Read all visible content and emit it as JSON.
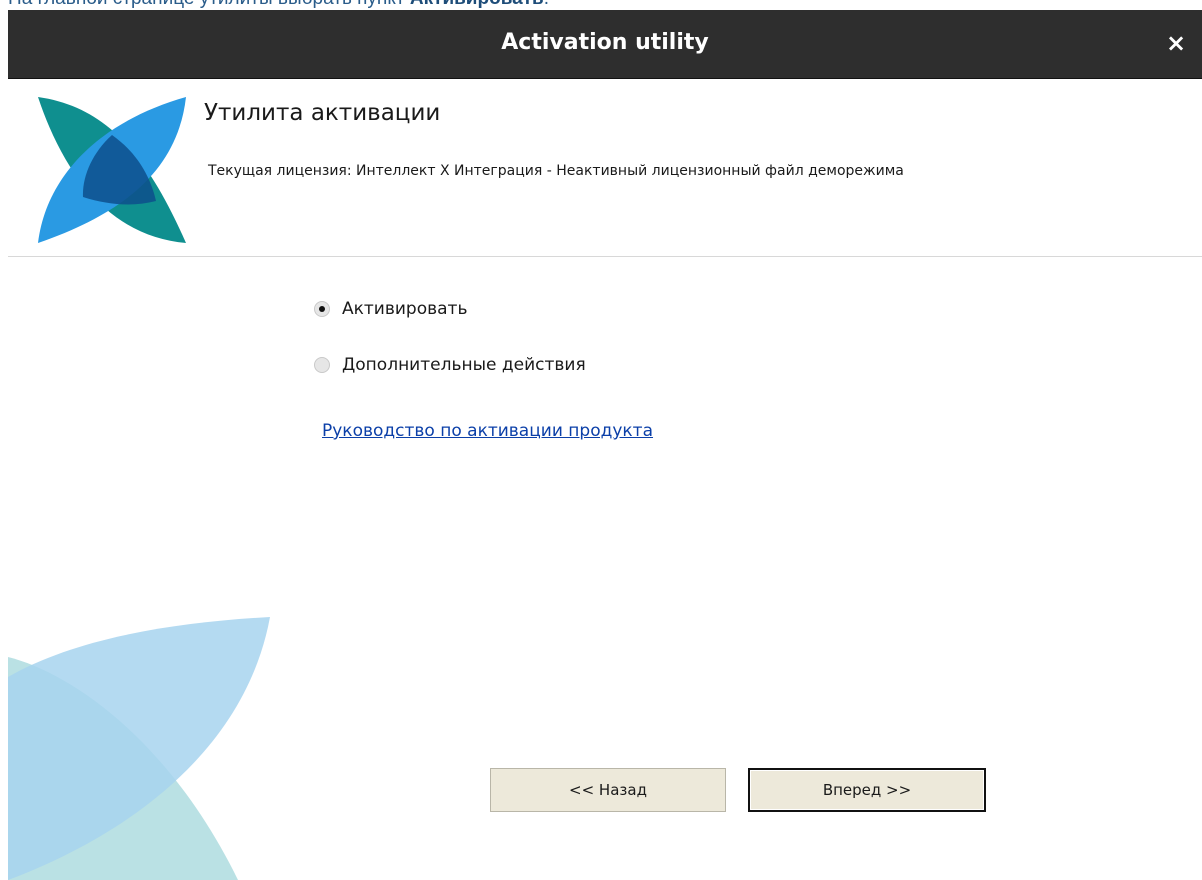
{
  "doc_caption": {
    "prefix": "На главной странице утилиты выбрать пункт ",
    "emphasis": "Активировать",
    "suffix": "."
  },
  "window": {
    "title": "Activation utility",
    "close_glyph": "×"
  },
  "header": {
    "title": "Утилита активации",
    "license_text": "Текущая лицензия: Интеллект X Интеграция - Неактивный лицензионный файл деморежима"
  },
  "options": [
    {
      "label": "Активировать",
      "checked": true
    },
    {
      "label": "Дополнительные действия",
      "checked": false
    }
  ],
  "guide_link": "Руководство по активации продукта",
  "buttons": {
    "back": "<< Назад",
    "next": "Вперед >>"
  },
  "colors": {
    "titlebar": "#2e2e2e",
    "logo_teal": "#0f8f8f",
    "logo_blue": "#2a9ae3",
    "logo_dark": "#0d4f8c",
    "button_bg": "#ede9da",
    "link": "#0b3fa8"
  }
}
